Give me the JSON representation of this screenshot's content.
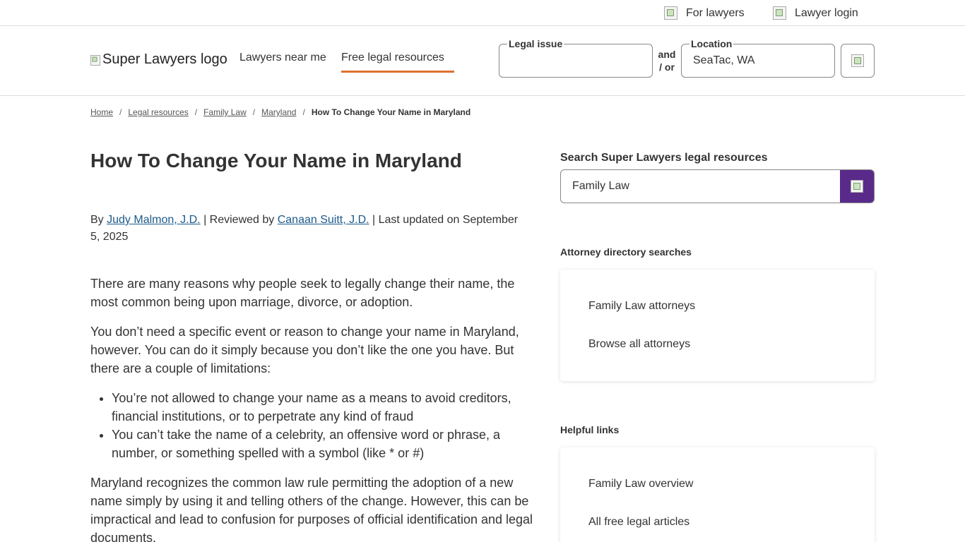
{
  "topbar": {
    "for_lawyers": "For lawyers",
    "lawyer_login": "Lawyer login"
  },
  "header": {
    "logo_alt": "Super Lawyers logo",
    "nav": {
      "lawyers_near_me": "Lawyers near me",
      "free_legal_resources": "Free legal resources"
    },
    "legal_issue_label": "Legal issue",
    "legal_issue_value": "",
    "and_or": "and / or",
    "location_label": "Location",
    "location_value": "SeaTac, WA"
  },
  "breadcrumb": {
    "home": "Home",
    "legal_resources": "Legal resources",
    "family_law": "Family Law",
    "maryland": "Maryland",
    "current": "How To Change Your Name in Maryland"
  },
  "article": {
    "title": "How To Change Your Name in Maryland",
    "by": "By",
    "author": "Judy Malmon, J.D.",
    "reviewed_by": "| Reviewed by",
    "reviewer": "Canaan Suitt, J.D.",
    "updated": "| Last updated on September 5, 2025",
    "p1": "There are many reasons why people seek to legally change their name, the most common being upon marriage, divorce, or adoption.",
    "p2": "You don’t need a specific event or reason to change your name in Maryland, however. You can do it simply because you don’t like the one you have. But there are a couple of limitations:",
    "bullets": [
      "You’re not allowed to change your name as a means to avoid creditors, financial institutions, or to perpetrate any kind of fraud",
      "You can’t take the name of a celebrity, an offensive word or phrase, a number, or something spelled with a symbol (like * or #)"
    ],
    "p3": "Maryland recognizes the common law rule permitting the adoption of a new name simply by using it and telling others of the change. However, this can be impractical and lead to confusion for purposes of official identification and legal documents."
  },
  "sidebar": {
    "search_label": "Search Super Lawyers legal resources",
    "search_value": "Family Law",
    "directory_heading": "Attorney directory searches",
    "directory_links": [
      "Family Law attorneys",
      "Browse all attorneys"
    ],
    "helpful_heading": "Helpful links",
    "helpful_links": [
      "Family Law overview",
      "All free legal articles"
    ]
  },
  "colors": {
    "accent_orange": "#e0702f",
    "search_button_purple": "#5a2a8a",
    "link_blue": "#1a5a8a"
  }
}
